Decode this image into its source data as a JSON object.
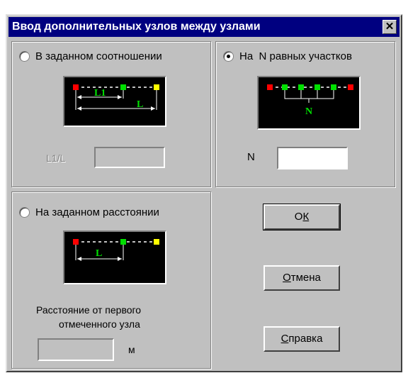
{
  "dialog": {
    "title": "Ввод дополнительных узлов между узлами",
    "close_glyph": "✕"
  },
  "ratio_group": {
    "radio_label": "В заданном соотношении",
    "pic_label_l1": "L1",
    "pic_label_l": "L",
    "field_label": "L1/L",
    "field_value": ""
  },
  "equal_group": {
    "radio_label": "На  N равных участков",
    "pic_label_n": "N",
    "field_label": "N",
    "field_value": ""
  },
  "distance_group": {
    "radio_label": "На заданном расстоянии",
    "pic_label_l": "L",
    "description_line1": "Расстояние от первого",
    "description_line2": "отмеченного узла",
    "field_value": "",
    "unit": "м"
  },
  "buttons": {
    "ok_first": "О",
    "ok_underlined": "К",
    "cancel_underlined": "О",
    "cancel_rest": "тмена",
    "help_underlined": "С",
    "help_rest": "правка"
  },
  "colors": {
    "node_red": "#ff0000",
    "node_green": "#00e000",
    "node_yellow": "#ffff00",
    "label_green": "#00e000"
  }
}
